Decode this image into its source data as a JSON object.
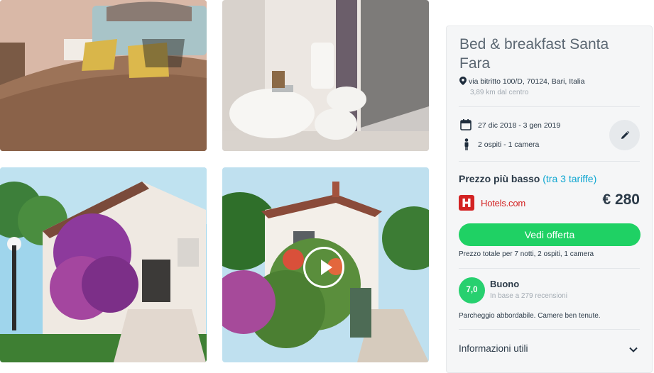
{
  "gallery": {
    "photos": [
      {
        "name": "bedroom-photo"
      },
      {
        "name": "bathroom-photo"
      },
      {
        "name": "exterior-photo"
      },
      {
        "name": "exterior-video"
      }
    ],
    "video_icon": "play-icon"
  },
  "hotel": {
    "title": "Bed & breakfast Santa Fara",
    "address": "via bitritto 100/D, 70124, Bari, Italia",
    "distance": "3,89 km dal centro"
  },
  "trip": {
    "dates": "27 dic 2018 - 3 gen 2019",
    "guests": "2 ospiti - 1 camera",
    "icons": {
      "dates": "calendar-icon",
      "guests": "person-icon",
      "edit": "pencil-icon"
    }
  },
  "pricing": {
    "heading": "Prezzo più basso",
    "rates_link": "(tra 3 tariffe)",
    "provider": "Hotels.com",
    "price": "€ 280",
    "cta": "Vedi offerta",
    "total_note": "Prezzo totale per 7 notti, 2 ospiti, 1 camera"
  },
  "rating": {
    "score": "7,0",
    "label": "Buono",
    "reviews": "In base a 279 recensioni",
    "summary": "Parcheggio abbordabile. Camere ben tenute."
  },
  "info": {
    "label": "Informazioni utili",
    "icon": "chevron-down-icon"
  },
  "colors": {
    "accent_green": "#1fd164",
    "score_green": "#27d06f",
    "link_blue": "#0fa6d1",
    "hotels_red": "#d32323"
  }
}
